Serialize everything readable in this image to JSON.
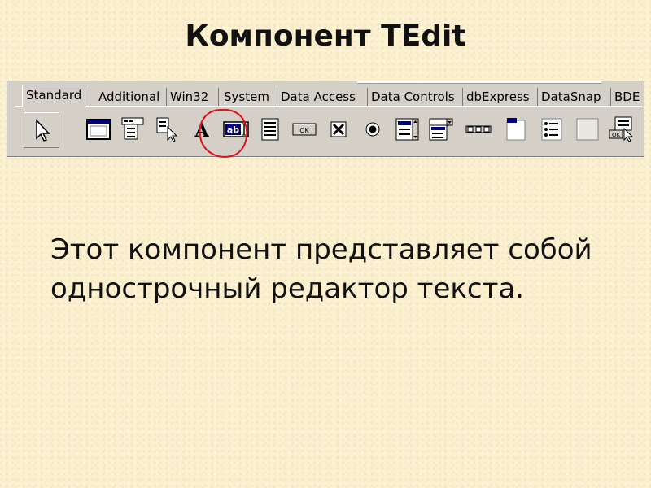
{
  "slide": {
    "title": "Компонент TEdit",
    "description": "Этот компонент представляет собой однострочный редактор текста."
  },
  "palette": {
    "tabs": [
      {
        "label": "Standard"
      },
      {
        "label": "Additional"
      },
      {
        "label": "Win32"
      },
      {
        "label": "System"
      },
      {
        "label": "Data Access"
      },
      {
        "label": "Data Controls"
      },
      {
        "label": "dbExpress"
      },
      {
        "label": "DataSnap"
      },
      {
        "label": "BDE"
      }
    ],
    "active_tab": "Standard",
    "components": [
      {
        "icon": "pointer-arrow-icon"
      },
      {
        "icon": "frame-icon"
      },
      {
        "icon": "main-menu-icon"
      },
      {
        "icon": "popup-menu-icon"
      },
      {
        "icon": "label-icon",
        "glyph": "A"
      },
      {
        "icon": "edit-icon",
        "glyph": "ab"
      },
      {
        "icon": "memo-icon"
      },
      {
        "icon": "button-icon",
        "glyph": "OK"
      },
      {
        "icon": "checkbox-icon"
      },
      {
        "icon": "radio-button-icon"
      },
      {
        "icon": "listbox-icon"
      },
      {
        "icon": "combobox-icon"
      },
      {
        "icon": "scrollbar-icon"
      },
      {
        "icon": "groupbox-icon"
      },
      {
        "icon": "radiogroup-icon"
      },
      {
        "icon": "panel-icon"
      },
      {
        "icon": "actionlist-icon",
        "glyph": "OK"
      }
    ],
    "highlight": {
      "target": "edit-icon",
      "color": "#e0101c"
    }
  }
}
